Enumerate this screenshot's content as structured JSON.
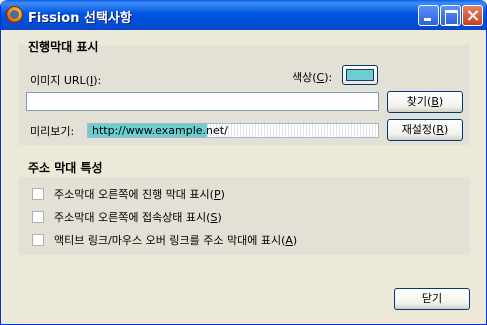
{
  "window": {
    "title": "Fission 선택사항",
    "icon": "firefox-icon"
  },
  "colors": {
    "titlebar": "#0054e3",
    "accent": "#6bcfd2",
    "window_bg": "#ece9d8"
  },
  "progress_group": {
    "title": "진행막대 표시",
    "image_url_label_prefix": "이미지 URL(",
    "image_url_label_key": "I",
    "image_url_label_suffix": "):",
    "image_url_value": "",
    "color_label_prefix": "색상(",
    "color_label_key": "C",
    "color_label_suffix": "):",
    "color_value": "#6bcfd2",
    "browse_label_prefix": "찾기(",
    "browse_label_key": "B",
    "browse_label_suffix": ")",
    "preview_label": "미리보기:",
    "preview_text": "http://www.example.net/",
    "preview_fill_fraction": 0.41,
    "reset_label_prefix": "재설정(",
    "reset_label_key": "R",
    "reset_label_suffix": ")"
  },
  "address_group": {
    "title": "주소 막대 특성",
    "options": [
      {
        "prefix": "주소막대 오른쪽에 진행 막대 표시(",
        "key": "P",
        "suffix": ")",
        "checked": false
      },
      {
        "prefix": "주소막대 오른쪽에 접속상태 표시(",
        "key": "S",
        "suffix": ")",
        "checked": false
      },
      {
        "prefix": "액티브 링크/마우스 오버 링크를 주소 막대에 표시(",
        "key": "A",
        "suffix": ")",
        "checked": false
      }
    ]
  },
  "footer": {
    "close_label": "닫기"
  }
}
